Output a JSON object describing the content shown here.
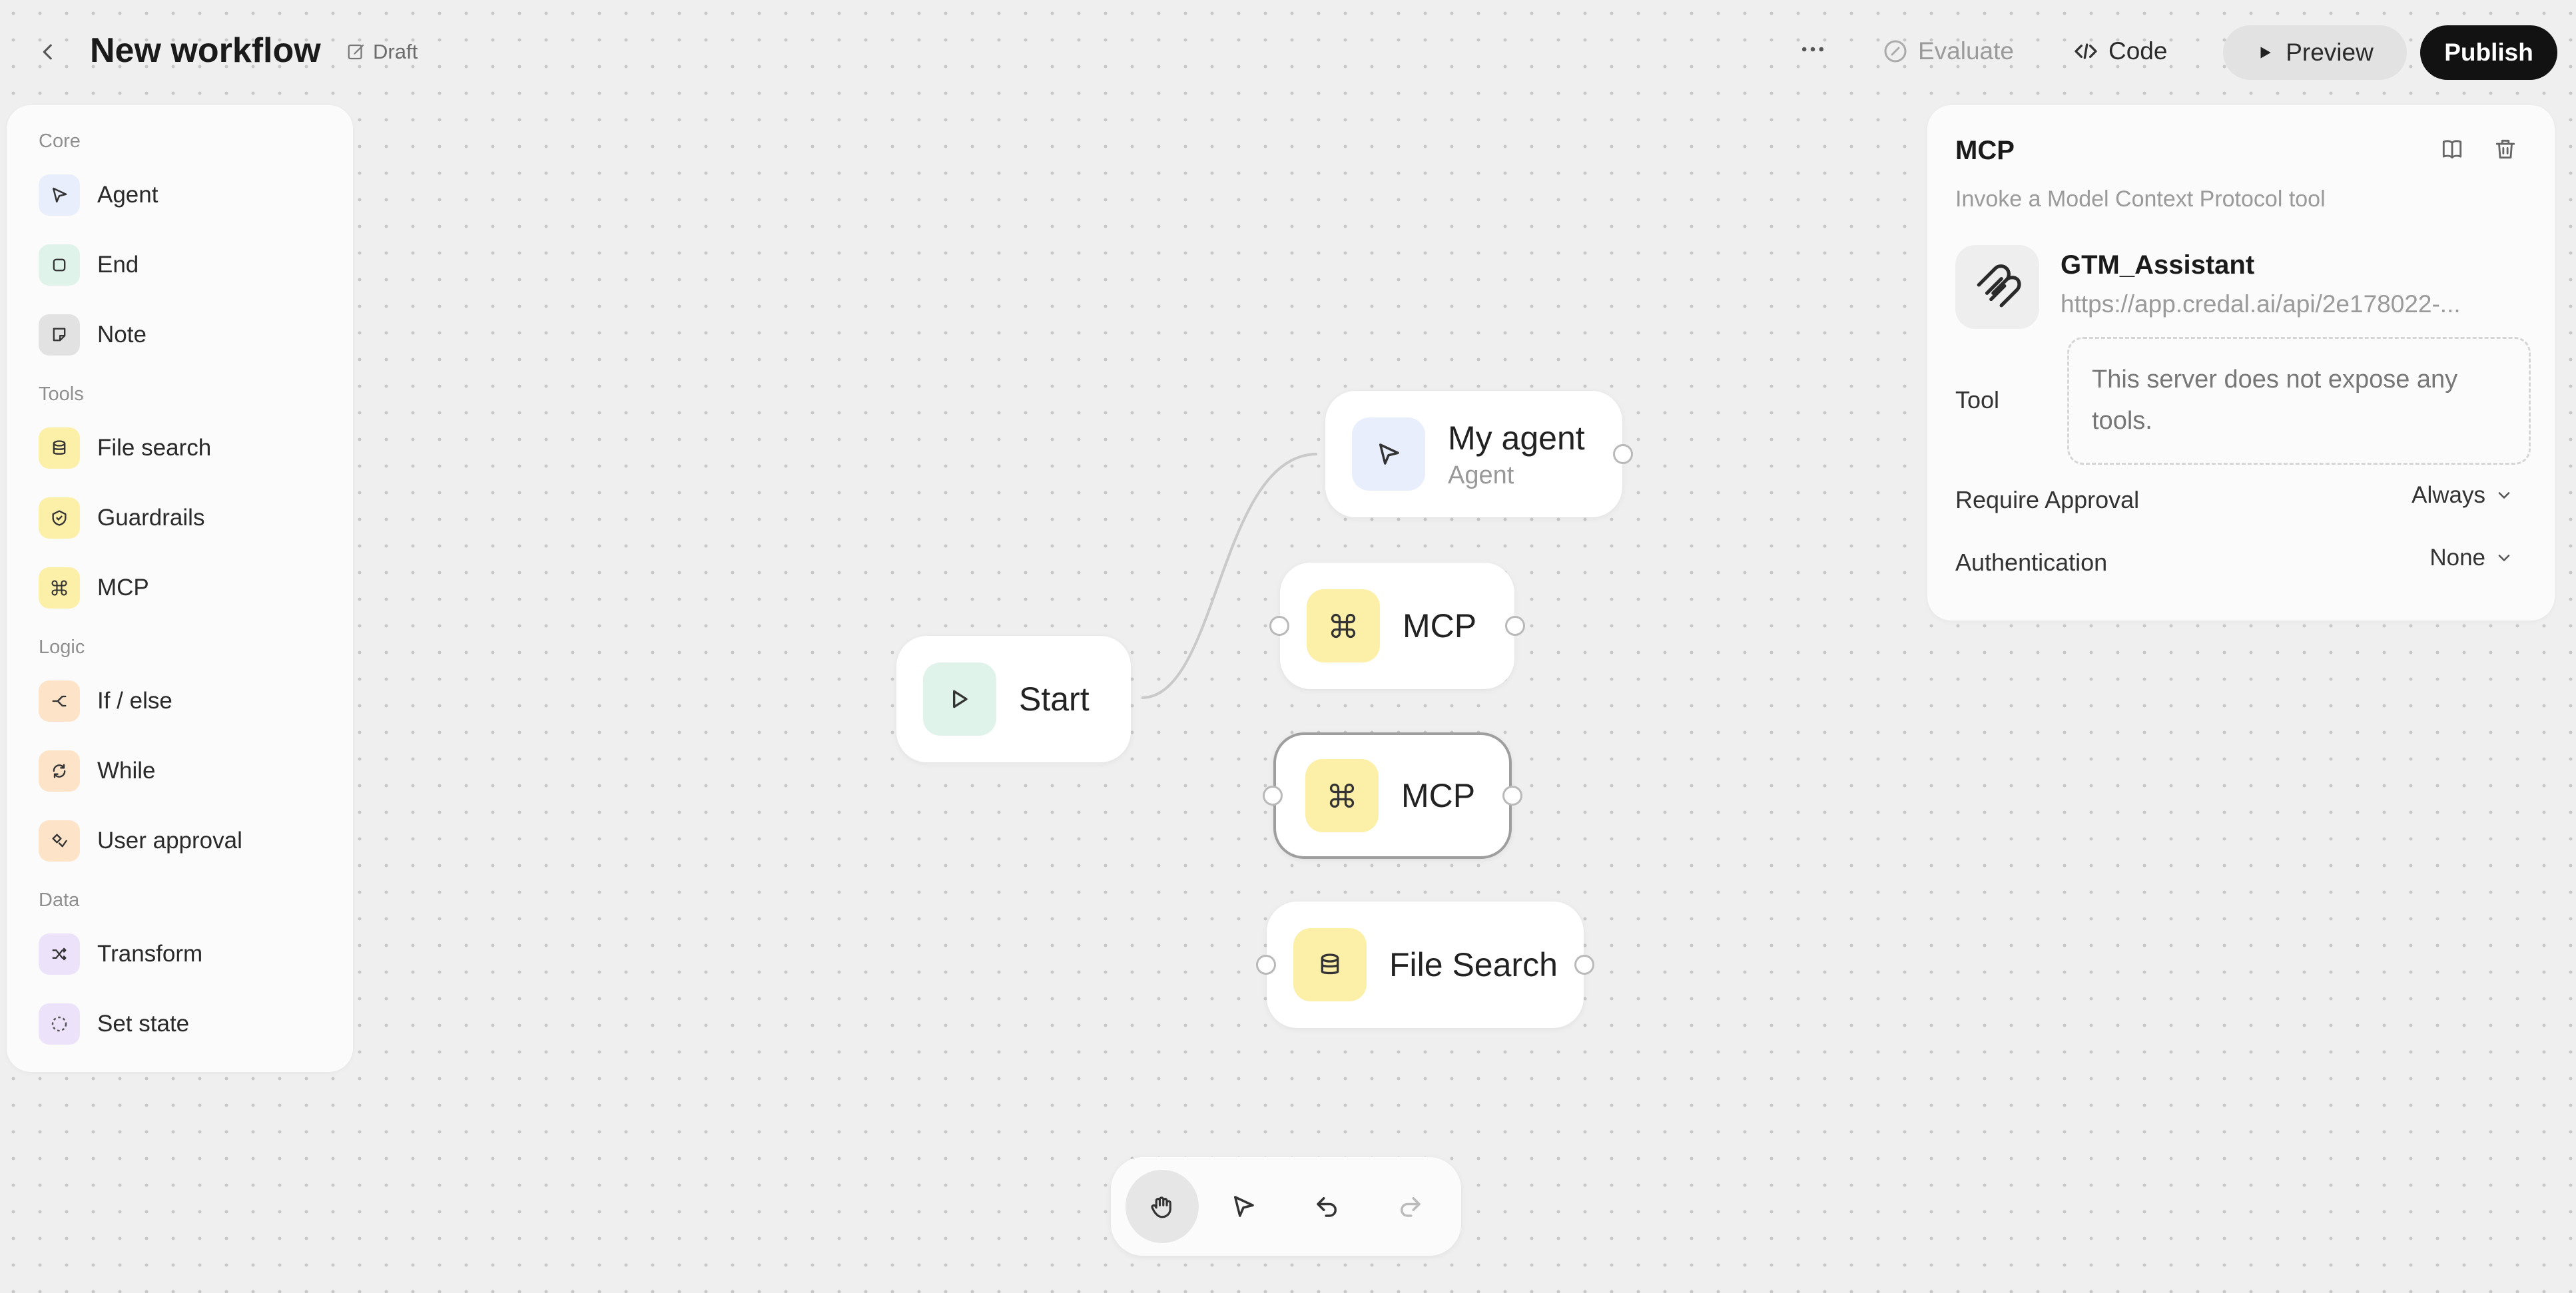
{
  "header": {
    "title": "New workflow",
    "draft_label": "Draft",
    "evaluate_label": "Evaluate",
    "code_label": "Code",
    "preview_label": "Preview",
    "publish_label": "Publish"
  },
  "sidebar": {
    "sections": [
      {
        "label": "Core"
      },
      {
        "label": "Tools"
      },
      {
        "label": "Logic"
      },
      {
        "label": "Data"
      }
    ],
    "items": [
      {
        "label": "Agent",
        "icon": "agent-icon"
      },
      {
        "label": "End",
        "icon": "end-icon"
      },
      {
        "label": "Note",
        "icon": "note-icon"
      },
      {
        "label": "File search",
        "icon": "database-icon"
      },
      {
        "label": "Guardrails",
        "icon": "shield-icon"
      },
      {
        "label": "MCP",
        "icon": "command-icon"
      },
      {
        "label": "If / else",
        "icon": "branch-icon"
      },
      {
        "label": "While",
        "icon": "loop-icon"
      },
      {
        "label": "User approval",
        "icon": "approval-icon"
      },
      {
        "label": "Transform",
        "icon": "shuffle-icon"
      },
      {
        "label": "Set state",
        "icon": "state-icon"
      }
    ]
  },
  "canvas": {
    "nodes": {
      "start": {
        "label": "Start"
      },
      "agent": {
        "label": "My agent",
        "sublabel": "Agent"
      },
      "mcp1": {
        "label": "MCP"
      },
      "mcp2": {
        "label": "MCP"
      },
      "file_search": {
        "label": "File Search"
      }
    }
  },
  "inspector": {
    "title": "MCP",
    "subtitle": "Invoke a Model Context Protocol tool",
    "server_name": "GTM_Assistant",
    "server_url": "https://app.credal.ai/api/2e178022-...",
    "tool_label": "Tool",
    "tool_message": "This server does not expose any tools.",
    "approval_label": "Require Approval",
    "approval_value": "Always",
    "auth_label": "Authentication",
    "auth_value": "None"
  },
  "colors": {
    "blue_tint": "#e9eefc",
    "green_tint": "#dff3ea",
    "gray_tint": "#e6e6e6",
    "yellow_tint": "#fcefa8",
    "orange_tint": "#fde3c8",
    "purple_tint": "#ece3fb",
    "publish_bg": "#121212"
  }
}
